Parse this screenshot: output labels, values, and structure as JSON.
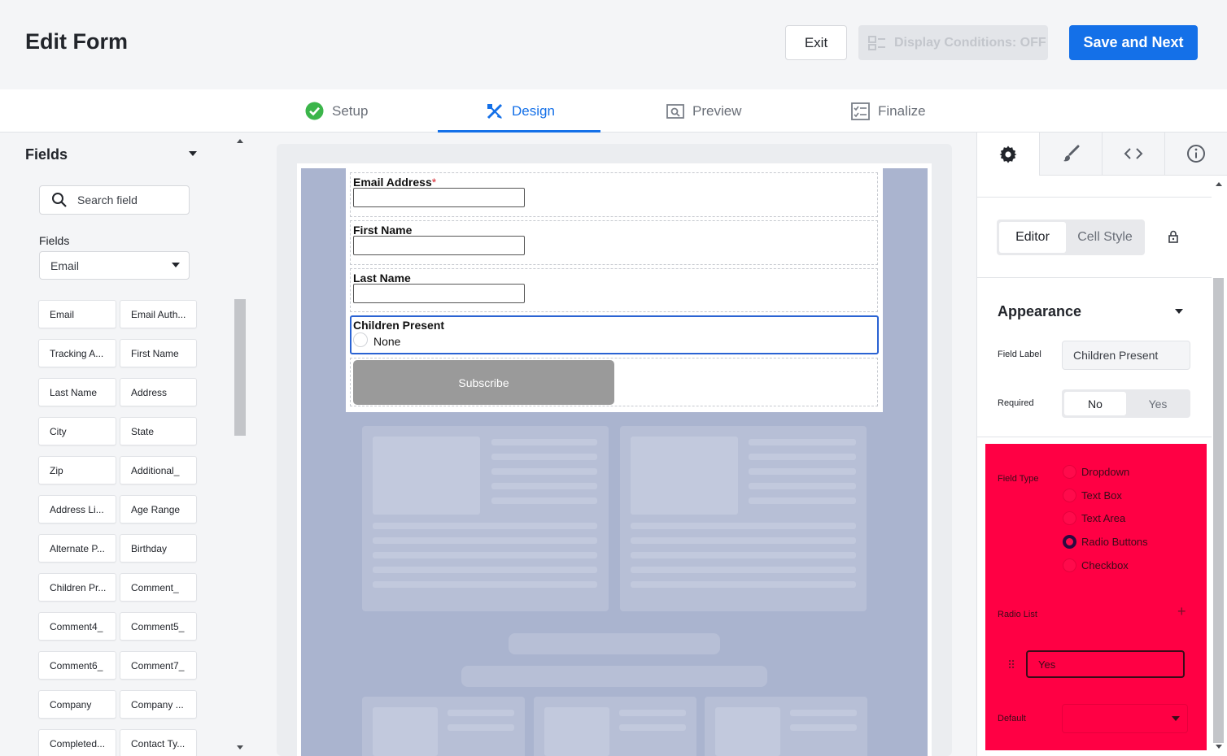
{
  "header": {
    "title": "Edit Form",
    "exit_label": "Exit",
    "display_conditions_label": "Display Conditions: OFF",
    "save_label": "Save and Next"
  },
  "tabs": [
    {
      "label": "Setup",
      "icon": "check-circle-icon",
      "state": "done"
    },
    {
      "label": "Design",
      "icon": "design-tools-icon",
      "state": "active"
    },
    {
      "label": "Preview",
      "icon": "preview-icon",
      "state": "inactive"
    },
    {
      "label": "Finalize",
      "icon": "finalize-icon",
      "state": "inactive"
    }
  ],
  "left_panel": {
    "title": "Fields",
    "search_placeholder": "Search field",
    "filter_label": "Fields",
    "filter_value": "Email",
    "fields": [
      "Email",
      "Email Auth...",
      "Tracking A...",
      "First Name",
      "Last Name",
      "Address",
      "City",
      "State",
      "Zip",
      "Additional_",
      "Address Li...",
      "Age Range",
      "Alternate P...",
      "Birthday",
      "Children Pr...",
      "Comment_",
      "Comment4_",
      "Comment5_",
      "Comment6_",
      "Comment7_",
      "Company",
      "Company ...",
      "Completed...",
      "Contact Ty..."
    ]
  },
  "form": {
    "fields": [
      {
        "label": "Email Address",
        "required_mark": "*"
      },
      {
        "label": "First Name"
      },
      {
        "label": "Last Name"
      }
    ],
    "selected_field": {
      "label": "Children Present",
      "option": "None"
    },
    "submit_label": "Subscribe"
  },
  "right_panel": {
    "tab_icons": [
      "gear-icon",
      "brush-icon",
      "code-icon",
      "info-icon"
    ],
    "mode_active": "Editor",
    "mode_inactive": "Cell Style",
    "section_title": "Appearance",
    "field_label_caption": "Field Label",
    "field_label_value": "Children Present",
    "required_caption": "Required",
    "required_no": "No",
    "required_yes": "Yes",
    "field_type_caption": "Field Type",
    "field_types": [
      "Dropdown",
      "Text Box",
      "Text Area",
      "Radio Buttons",
      "Checkbox"
    ],
    "field_type_selected": "Radio Buttons",
    "radio_list_caption": "Radio List",
    "radio_list_value": "Yes",
    "default_caption": "Default",
    "highlight_color": "#ff0044"
  },
  "colors": {
    "accent": "#1470e8",
    "success": "#3bb54a",
    "canvas_bg": "#aab4cf"
  }
}
